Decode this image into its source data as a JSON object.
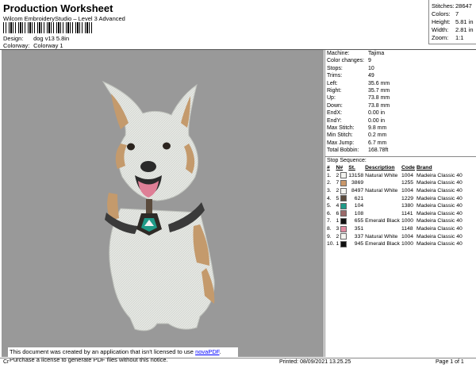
{
  "header": {
    "title": "Production Worksheet",
    "software": "Wilcom EmbroideryStudio – Level 3 Advanced",
    "design_label": "Design:",
    "design_value": "dog v13 5.8in",
    "colorway_label": "Colorway:",
    "colorway_value": "Colorway 1"
  },
  "summary": [
    {
      "label": "Stitches:",
      "value": "28647"
    },
    {
      "label": "Colors:",
      "value": "7"
    },
    {
      "label": "Height:",
      "value": "5.81 in"
    },
    {
      "label": "Width:",
      "value": "2.81 in"
    },
    {
      "label": "Zoom:",
      "value": "1:1"
    }
  ],
  "machine_info": [
    {
      "label": "Machine:",
      "value": "Tajima"
    },
    {
      "label": "Color changes:",
      "value": "9"
    },
    {
      "label": "Stops:",
      "value": "10"
    },
    {
      "label": "Trims:",
      "value": "49"
    },
    {
      "label": "Left:",
      "value": "35.6 mm"
    },
    {
      "label": "Right:",
      "value": "35.7 mm"
    },
    {
      "label": "Up:",
      "value": "73.8 mm"
    },
    {
      "label": "Down:",
      "value": "73.8 mm"
    },
    {
      "label": "EndX:",
      "value": "0.00 in"
    },
    {
      "label": "EndY:",
      "value": "0.00 in"
    },
    {
      "label": "Max Stitch:",
      "value": "9.8 mm"
    },
    {
      "label": "Min Stitch:",
      "value": "0.2 mm"
    },
    {
      "label": "Max Jump:",
      "value": "6.7 mm"
    },
    {
      "label": "Total Bobbin:",
      "value": "168.78ft"
    }
  ],
  "stop_sequence": {
    "title": "Stop Sequence:",
    "columns": [
      "#",
      "N#",
      "St.",
      "Description",
      "Code",
      "Brand"
    ],
    "rows": [
      {
        "n": "1.",
        "needle": "2",
        "color": "#f4f4f0",
        "st": "13158",
        "desc": "Natural White",
        "code": "1004",
        "brand": "Madeira Classic 40"
      },
      {
        "n": "2.",
        "needle": "7",
        "color": "#c9976a",
        "st": "3869",
        "desc": "",
        "code": "1255",
        "brand": "Madeira Classic 40"
      },
      {
        "n": "3.",
        "needle": "2",
        "color": "#f4f4f0",
        "st": "8497",
        "desc": "Natural White",
        "code": "1004",
        "brand": "Madeira Classic 40"
      },
      {
        "n": "4.",
        "needle": "5",
        "color": "#5a4a3c",
        "st": "621",
        "desc": "",
        "code": "1229",
        "brand": "Madeira Classic 40"
      },
      {
        "n": "5.",
        "needle": "4",
        "color": "#1f9a88",
        "st": "104",
        "desc": "",
        "code": "1380",
        "brand": "Madeira Classic 40"
      },
      {
        "n": "6.",
        "needle": "6",
        "color": "#9b6a6a",
        "st": "108",
        "desc": "",
        "code": "1141",
        "brand": "Madeira Classic 40"
      },
      {
        "n": "7.",
        "needle": "1",
        "color": "#111111",
        "st": "655",
        "desc": "Emerald Black",
        "code": "1000",
        "brand": "Madeira Classic 40"
      },
      {
        "n": "8.",
        "needle": "3",
        "color": "#e08aa0",
        "st": "351",
        "desc": "",
        "code": "1148",
        "brand": "Madeira Classic 40"
      },
      {
        "n": "9.",
        "needle": "2",
        "color": "#f4f4f0",
        "st": "337",
        "desc": "Natural White",
        "code": "1004",
        "brand": "Madeira Classic 40"
      },
      {
        "n": "10.",
        "needle": "1",
        "color": "#111111",
        "st": "945",
        "desc": "Emerald Black",
        "code": "1000",
        "brand": "Madeira Classic 40"
      }
    ]
  },
  "notice": {
    "line1": "This document was created by an application that isn't licensed to use ",
    "link": "novaPDF",
    "line1_end": ".",
    "line2": "Purchase a license to generate PDF files without this notice."
  },
  "footer": {
    "cr": "Cr",
    "printed": "Printed: 08/09/2021 13.25.25",
    "page": "Page 1 of 1"
  }
}
